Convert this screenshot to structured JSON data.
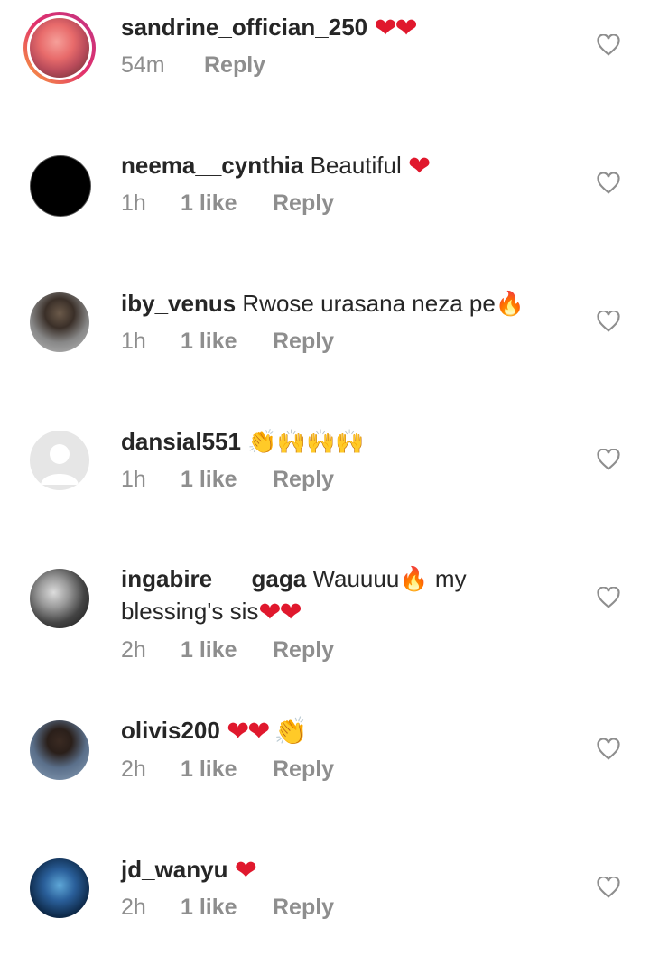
{
  "comments": [
    {
      "username": "sandrine_offician_250",
      "text": "",
      "emoji": "❤❤",
      "time": "54m",
      "likes": "",
      "reply": "Reply"
    },
    {
      "username": "neema__cynthia",
      "text": "Beautiful",
      "emoji": "❤",
      "time": "1h",
      "likes": "1 like",
      "reply": "Reply"
    },
    {
      "username": "iby_venus",
      "text": "Rwose urasana neza pe",
      "emoji": "🔥",
      "time": "1h",
      "likes": "1 like",
      "reply": "Reply"
    },
    {
      "username": "dansial551",
      "text": "",
      "emoji": "👏🙌🙌🙌",
      "time": "1h",
      "likes": "1 like",
      "reply": "Reply"
    },
    {
      "username": "ingabire___gaga",
      "text": "Wauuuu",
      "emoji": "🔥",
      "text2": "my blessing's sis",
      "emoji2": "❤❤",
      "time": "2h",
      "likes": "1 like",
      "reply": "Reply"
    },
    {
      "username": "olivis200",
      "text": "",
      "emoji": "❤❤ 👏",
      "time": "2h",
      "likes": "1 like",
      "reply": "Reply"
    },
    {
      "username": "jd_wanyu",
      "text": "",
      "emoji": "❤",
      "time": "2h",
      "likes": "1 like",
      "reply": "Reply"
    }
  ],
  "icons": {
    "like": "heart-outline-icon"
  },
  "colors": {
    "text": "#262626",
    "meta": "#8e8e8e",
    "heart": "#e0182d"
  }
}
